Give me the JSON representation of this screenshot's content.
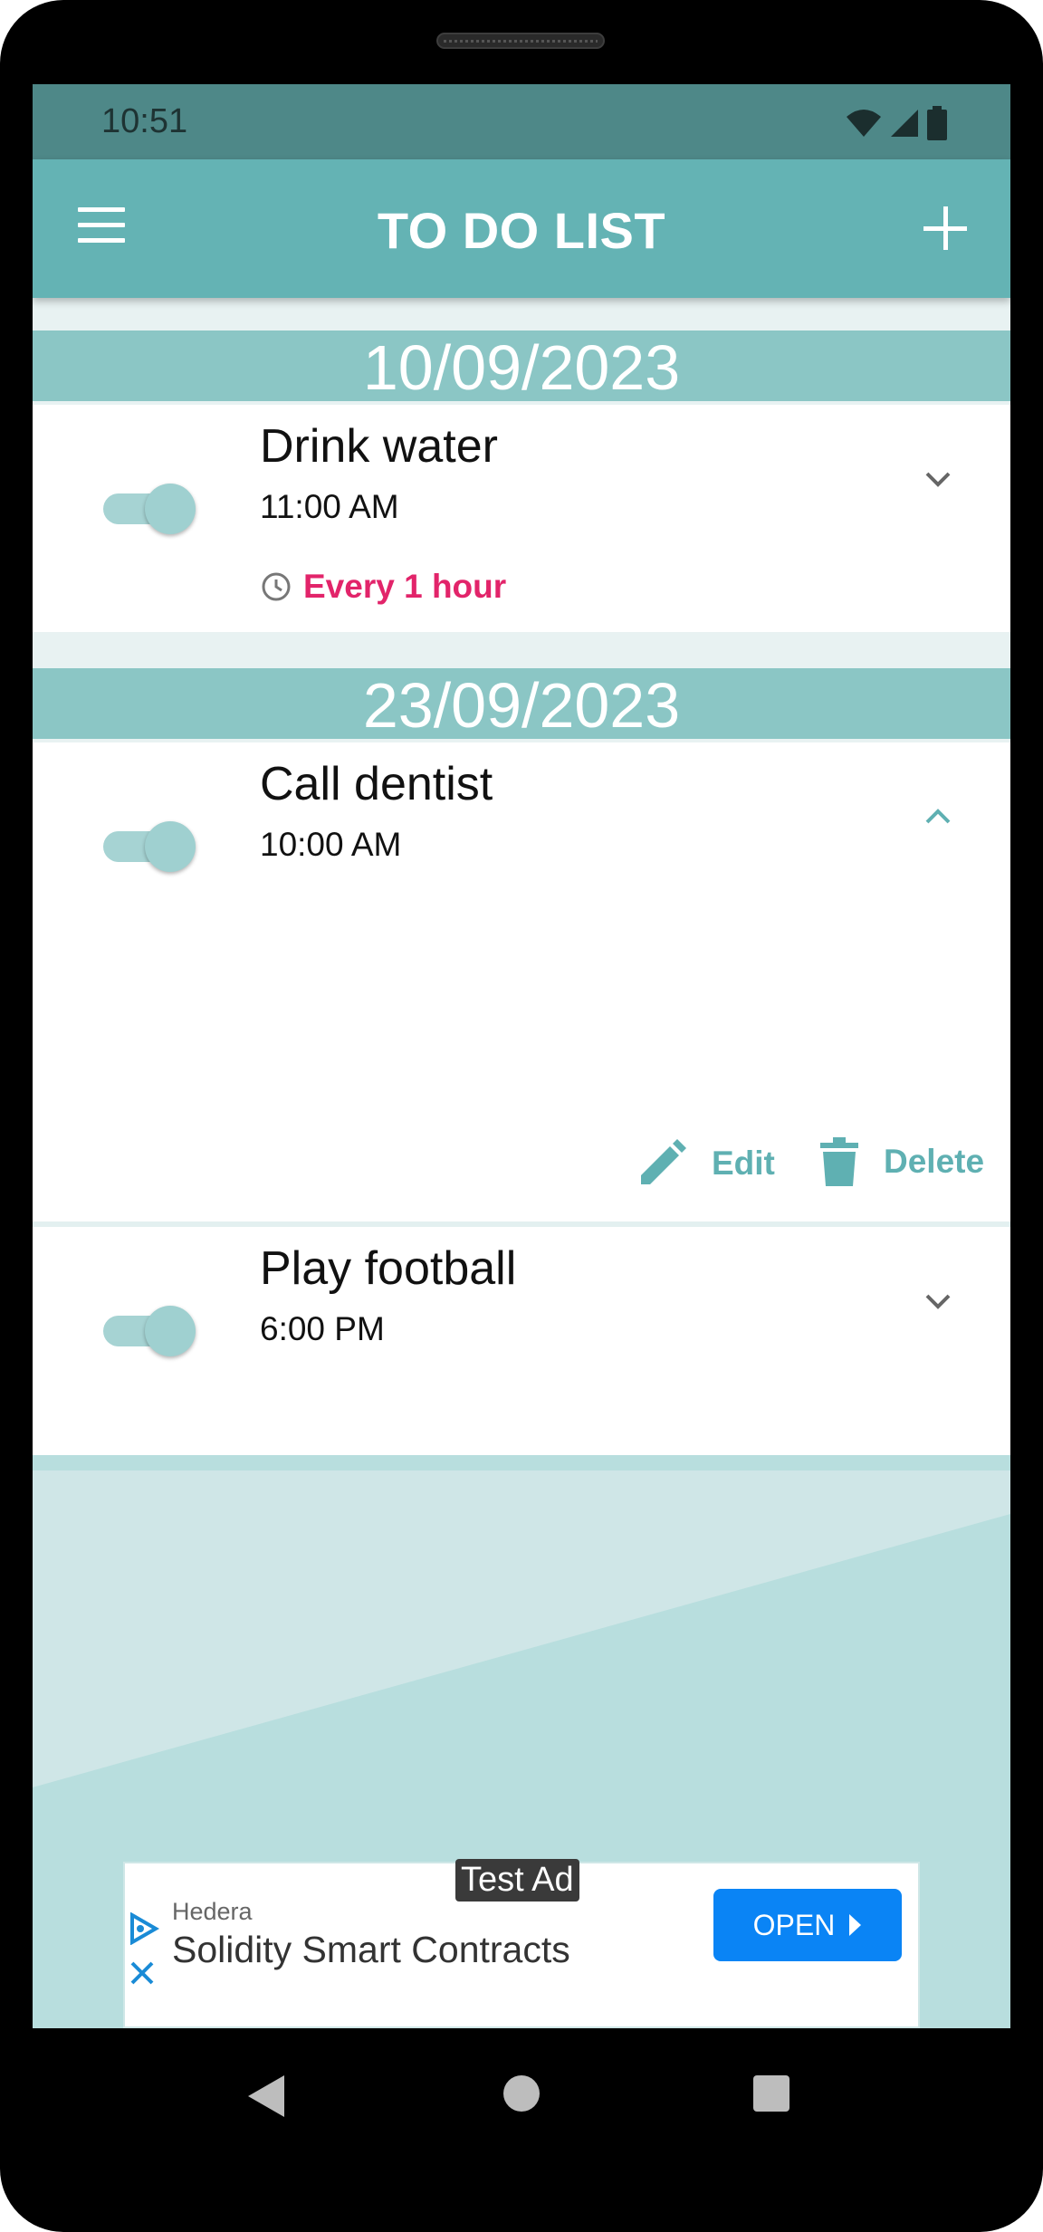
{
  "status_bar": {
    "time": "10:51",
    "icons": [
      "wifi-icon",
      "signal-icon",
      "battery-icon"
    ]
  },
  "app_bar": {
    "title": "TO DO LIST",
    "menu_icon": "menu-icon",
    "add_icon": "add-icon"
  },
  "groups": [
    {
      "date": "10/09/2023",
      "tasks": [
        {
          "title": "Drink water",
          "time": "11:00 AM",
          "repeat": "Every 1 hour",
          "enabled": true,
          "expanded": false
        }
      ]
    },
    {
      "date": "23/09/2023",
      "tasks": [
        {
          "title": "Call dentist",
          "time": "10:00 AM",
          "enabled": true,
          "expanded": true,
          "actions": {
            "edit": "Edit",
            "delete": "Delete"
          }
        },
        {
          "title": "Play football",
          "time": "6:00 PM",
          "enabled": true,
          "expanded": false
        }
      ]
    }
  ],
  "ad": {
    "badge": "Test Ad",
    "advertiser": "Hedera",
    "headline": "Solidity Smart Contracts",
    "cta": "OPEN"
  },
  "colors": {
    "primary": "#64b3b4",
    "status_bar": "#4e8888",
    "date_header": "#8bc6c5",
    "repeat_accent": "#e2246a",
    "ad_button": "#0a84f5"
  }
}
